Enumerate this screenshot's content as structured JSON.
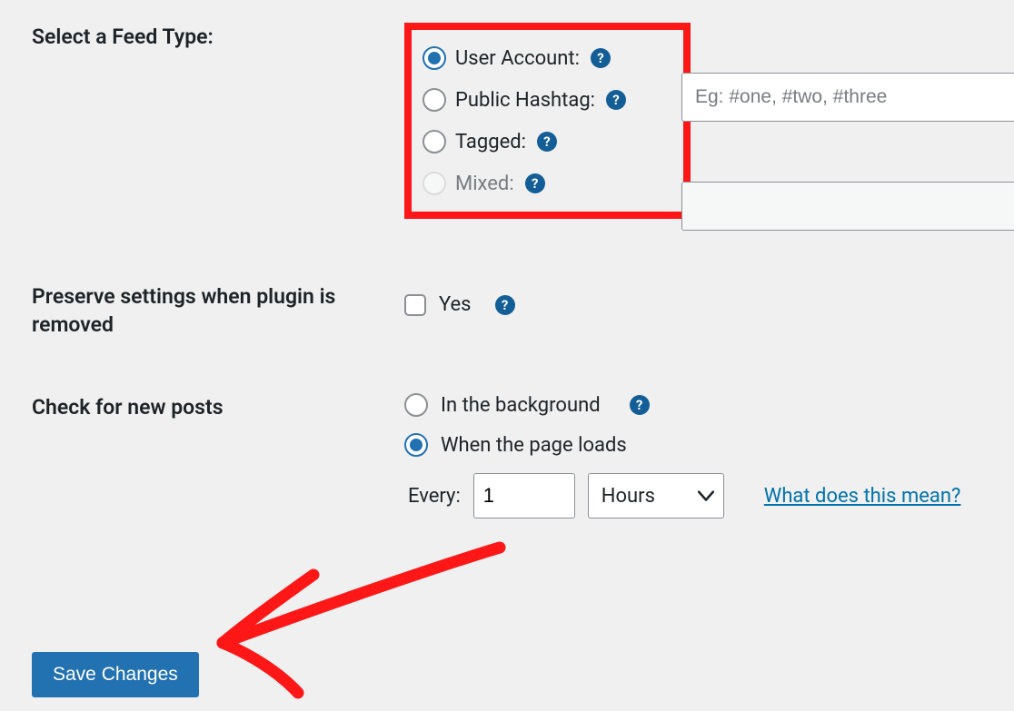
{
  "feedType": {
    "label": "Select a Feed Type:",
    "options": {
      "user": "User Account:",
      "hashtag": "Public Hashtag:",
      "tagged": "Tagged:",
      "mixed": "Mixed:"
    },
    "hashtag_placeholder": "Eg: #one, #two, #three"
  },
  "preserve": {
    "label": "Preserve settings when plugin is removed",
    "yes": "Yes"
  },
  "checkPosts": {
    "label": "Check for new posts",
    "background": "In the background",
    "pageload": "When the page loads",
    "every": "Every:",
    "interval_value": "1",
    "interval_unit": "Hours",
    "what_link": "What does this mean?"
  },
  "save_label": "Save Changes"
}
